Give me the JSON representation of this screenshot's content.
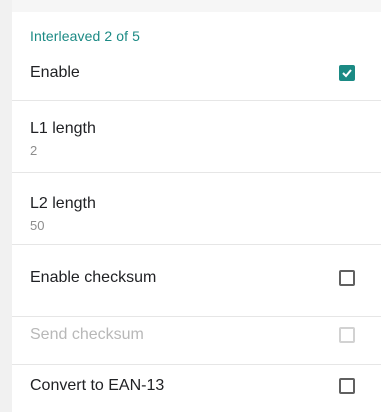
{
  "section": {
    "header": "Interleaved 2 of 5"
  },
  "settings": {
    "enable": {
      "label": "Enable",
      "checked": true
    },
    "l1_length": {
      "label": "L1 length",
      "value": "2"
    },
    "l2_length": {
      "label": "L2 length",
      "value": "50"
    },
    "enable_checksum": {
      "label": "Enable checksum",
      "checked": false
    },
    "send_checksum": {
      "label": "Send checksum",
      "checked": false,
      "disabled": true
    },
    "convert_ean13": {
      "label": "Convert to EAN-13",
      "checked": false
    }
  },
  "colors": {
    "accent": "#1b8a84",
    "text": "#202124",
    "secondary_text": "#8d8d8d",
    "disabled_text": "#b8b8b8"
  }
}
